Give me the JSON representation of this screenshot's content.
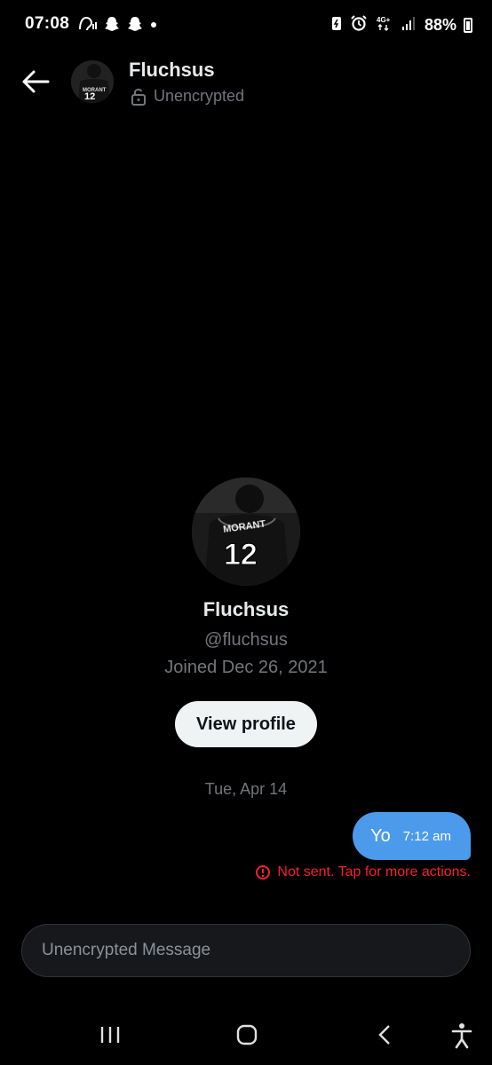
{
  "status_bar": {
    "time": "07:08",
    "battery": "88%",
    "network": "4G+"
  },
  "header": {
    "name": "Fluchsus",
    "encryption": "Unencrypted"
  },
  "profile": {
    "name": "Fluchsus",
    "handle": "@fluchsus",
    "joined": "Joined Dec 26, 2021",
    "view_profile_label": "View profile",
    "jersey_name": "MORANT",
    "jersey_number": "12"
  },
  "conversation": {
    "date": "Tue, Apr 14",
    "messages": [
      {
        "text": "Yo",
        "time": "7:12 am",
        "status": "Not sent. Tap for more actions."
      }
    ]
  },
  "composer": {
    "placeholder": "Unencrypted Message"
  },
  "colors": {
    "background": "#000000",
    "bubble": "#4c9aeb",
    "error": "#f4212e",
    "muted": "#71767b"
  }
}
